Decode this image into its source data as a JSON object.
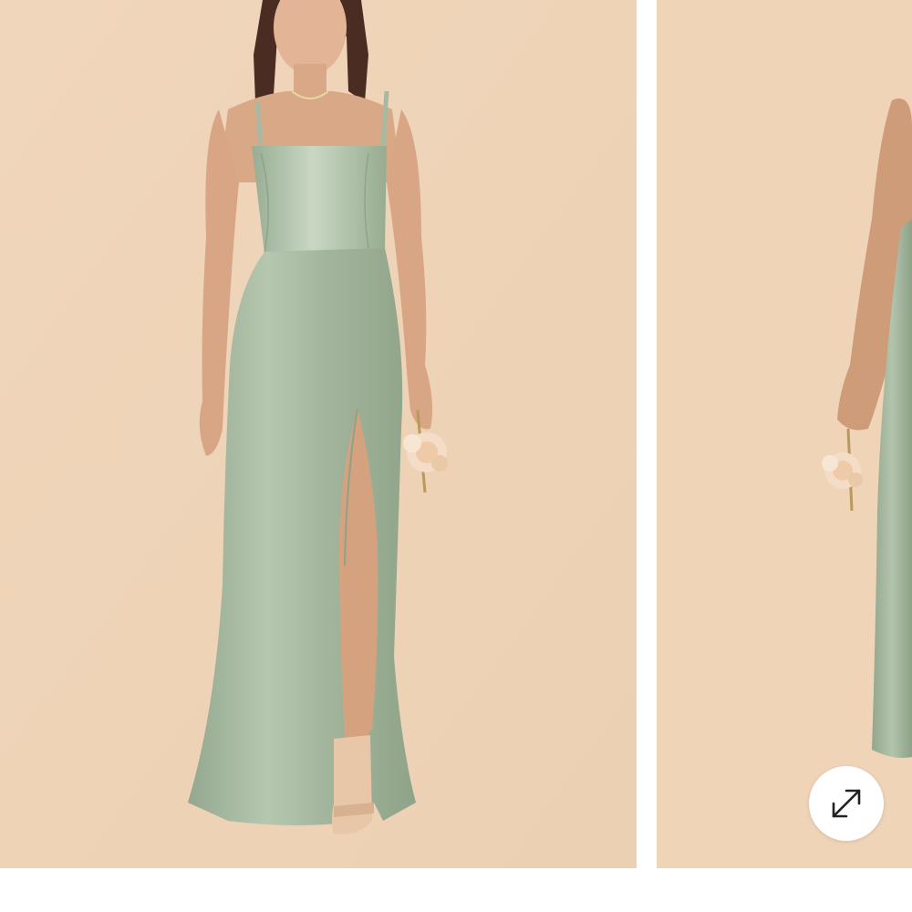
{
  "gallery": {
    "slides": [
      {
        "name": "product-photo-front",
        "background": "#efd4b8",
        "dress_color": "#a7b9a1"
      },
      {
        "name": "product-photo-side",
        "background": "#efd4b8",
        "dress_color": "#a7b9a1"
      }
    ],
    "expand_button": {
      "icon": "expand-arrows-icon",
      "background": "#ffffff",
      "icon_color": "#222222"
    }
  },
  "colors": {
    "page_background": "#ffffff",
    "photo_background": "#efd4b8",
    "dress_sage": "#a7b9a1",
    "skin": "#d9a886",
    "hair": "#4a2c22"
  }
}
